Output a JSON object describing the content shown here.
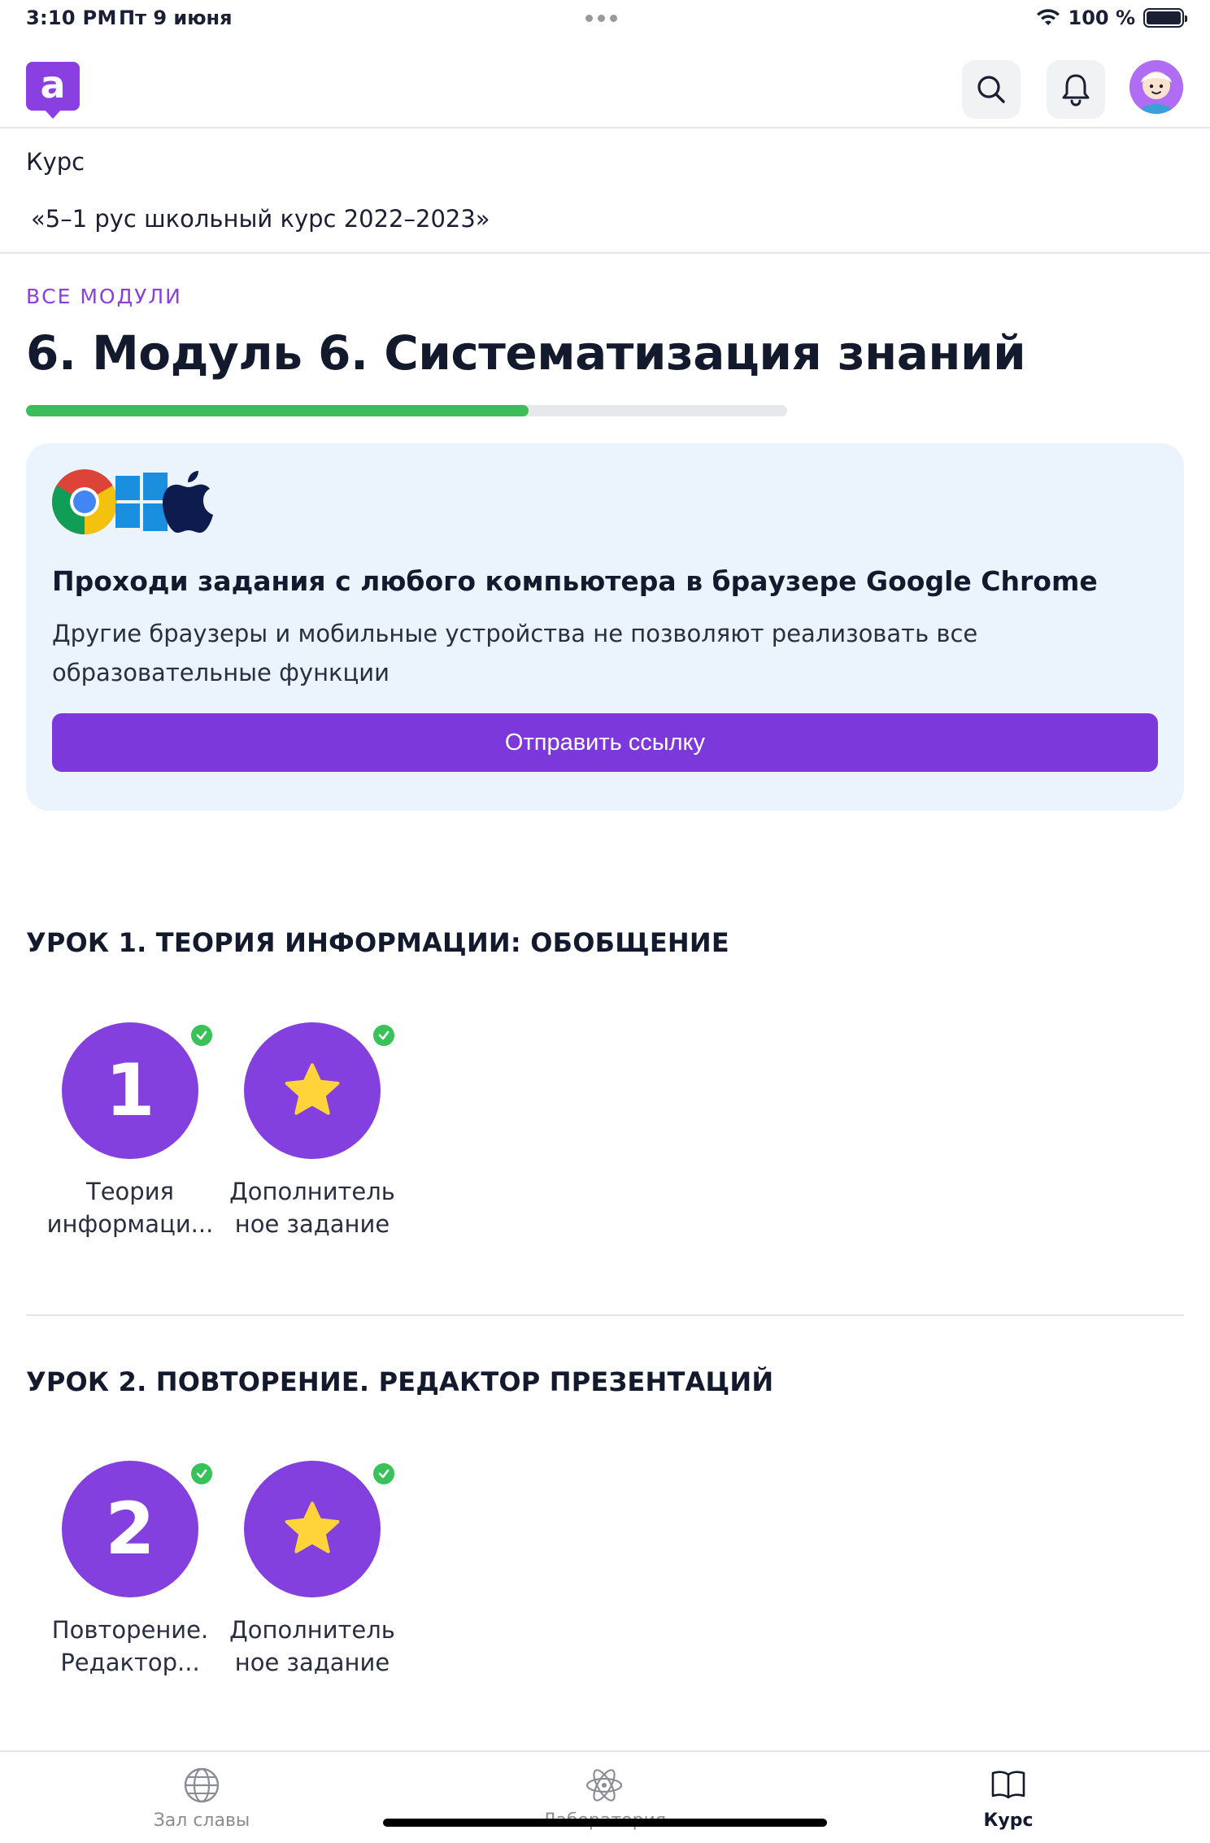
{
  "status_bar": {
    "time": "3:10 PM",
    "date": "Пт 9 июня",
    "battery_text": "100 %",
    "battery_level": 1.0
  },
  "header": {
    "logo_letter": "a",
    "icons": [
      "search-icon",
      "bell-icon",
      "avatar"
    ]
  },
  "course": {
    "label": "Курс",
    "name": "«5–1 рус школьный курс 2022–2023»"
  },
  "module": {
    "back_link": "ВСЕ МОДУЛИ",
    "title": "6. Модуль 6. Систематизация знаний",
    "progress": 0.66
  },
  "banner": {
    "icons": [
      "chrome-icon",
      "windows-icon",
      "apple-icon"
    ],
    "title": "Проходи задания с любого компьютера в браузере Google Chrome",
    "text": "Другие браузеры и мобильные устройства не позволяют реализовать все образовательные функции",
    "button": "Отправить ссылку"
  },
  "lessons": [
    {
      "title": "УРОК 1. ТЕОРИЯ ИНФОРМАЦИИ: ОБОБЩЕНИЕ",
      "tasks": [
        {
          "symbol": "1",
          "label": "Теория информаци...",
          "completed": true
        },
        {
          "symbol": "star",
          "label": "Дополнитель ное задание",
          "completed": true
        }
      ]
    },
    {
      "title": "УРОК 2. ПОВТОРЕНИЕ. РЕДАКТОР ПРЕЗЕНТАЦИЙ",
      "tasks": [
        {
          "symbol": "2",
          "label": "Повторение. Редактор...",
          "completed": true
        },
        {
          "symbol": "star",
          "label": "Дополнитель ное задание",
          "completed": true
        }
      ]
    }
  ],
  "tab_bar": {
    "tabs": [
      {
        "label": "Зал славы",
        "icon": "globe-icon",
        "active": false
      },
      {
        "label": "Лаборатория",
        "icon": "atom-icon",
        "active": false
      },
      {
        "label": "Курс",
        "icon": "book-icon",
        "active": true
      }
    ]
  },
  "colors": {
    "brand": "#8a3fe0",
    "button": "#7d38dc",
    "progress": "#3dbd5a",
    "check": "#37c25a",
    "banner_bg": "#ebf4fd"
  }
}
